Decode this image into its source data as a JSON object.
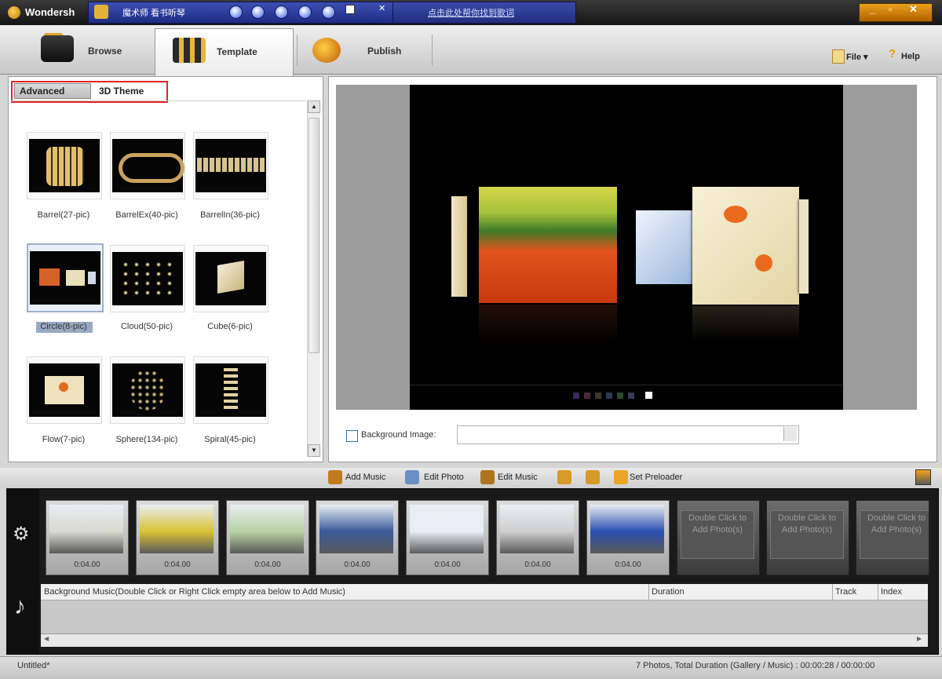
{
  "window": {
    "title": "Wondersh",
    "overlay_text": "魔术师 看书听琴",
    "overlay_link": "点击此处帮你找到歌词",
    "controls": [
      "_",
      "▫",
      "✕"
    ]
  },
  "toolbar": {
    "tabs": [
      {
        "label": "Browse",
        "icon": "folder-icon"
      },
      {
        "label": "Template",
        "icon": "film-template-icon"
      },
      {
        "label": "Publish",
        "icon": "publish-disc-icon"
      }
    ],
    "file_menu": "File ▾",
    "help": "Help"
  },
  "template_panel": {
    "subtabs": [
      "Advanced",
      "3D Theme"
    ],
    "active_subtab": "Advanced",
    "templates": [
      {
        "label": "Barrel(27-pic)"
      },
      {
        "label": "BarrelEx(40-pic)"
      },
      {
        "label": "BarrelIn(36-pic)"
      },
      {
        "label": "Circle(8-pic)",
        "selected": true
      },
      {
        "label": "Cloud(50-pic)"
      },
      {
        "label": "Cube(6-pic)"
      },
      {
        "label": "Flow(7-pic)"
      },
      {
        "label": "Sphere(134-pic)"
      },
      {
        "label": "Spiral(45-pic)"
      }
    ]
  },
  "preview": {
    "background_image_label": "Background Image:",
    "background_image_value": "",
    "pager_dots": 7
  },
  "actions": {
    "add_music": "Add Music",
    "edit_photo": "Edit Photo",
    "edit_music": "Edit Music",
    "set_preloader": "Set Preloader"
  },
  "storyboard": {
    "slots": [
      {
        "time": "0:04.00",
        "color": "#d9d9d2"
      },
      {
        "time": "0:04.00",
        "color": "#d9c233"
      },
      {
        "time": "0:04.00",
        "color": "#b7d2a0"
      },
      {
        "time": "0:04.00",
        "color": "#3a5a98"
      },
      {
        "time": "0:04.00",
        "color": "#e8eef6"
      },
      {
        "time": "0:04.00",
        "color": "#cfcfcf"
      },
      {
        "time": "0:04.00",
        "color": "#2a4fb0"
      }
    ],
    "empty_slot_text": "Double Click to Add Photo(s)",
    "empty_slots": 3
  },
  "music_list": {
    "headers": {
      "name": "Background Music(Double Click or Right Click empty area below to Add Music)",
      "duration": "Duration",
      "track": "Track",
      "index": "Index"
    }
  },
  "status": {
    "left": "Untitled*",
    "right": "7 Photos, Total Duration (Gallery / Music) : 00:00:28 / 00:00:00"
  }
}
